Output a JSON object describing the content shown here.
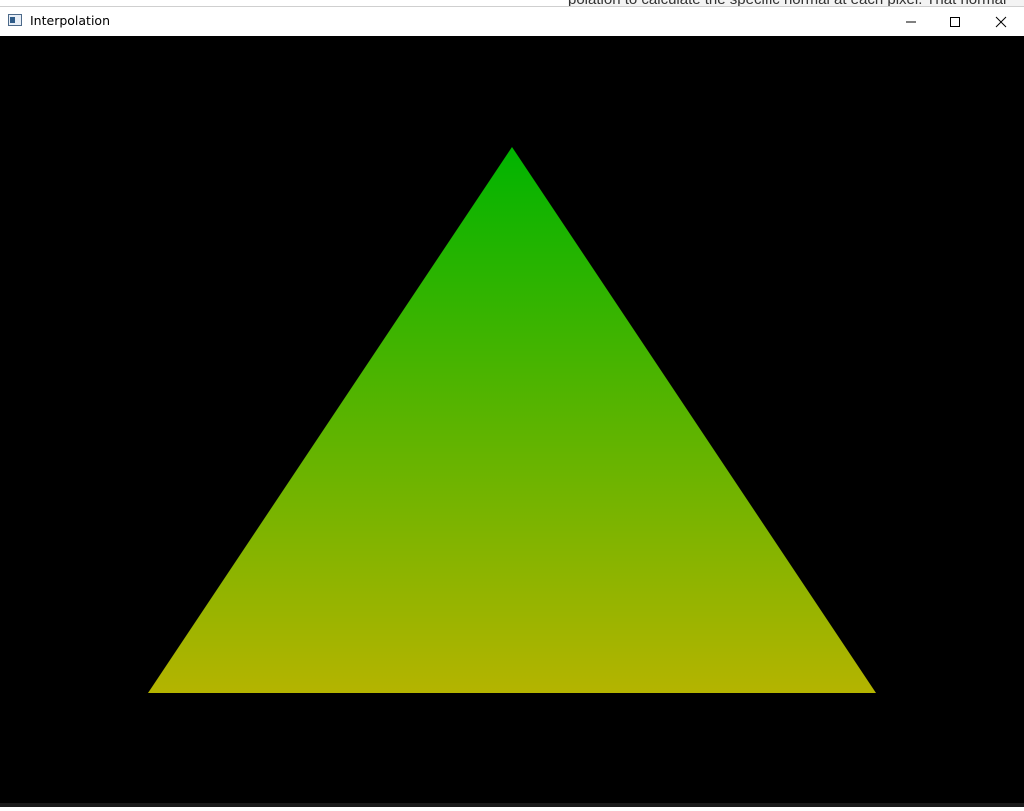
{
  "window": {
    "title": "Interpolation",
    "app_icon": "console-window-icon",
    "controls": {
      "minimize_icon": "minimize-icon",
      "maximize_icon": "maximize-icon",
      "close_icon": "close-icon"
    }
  },
  "background_window": {
    "text": "polation to calculate the specific normal at each pixel. That normal"
  },
  "scene": {
    "shape": "triangle",
    "colors": {
      "top_vertex": "#00b400",
      "bottom_vertices": "#b4b400",
      "background": "#000000"
    }
  }
}
